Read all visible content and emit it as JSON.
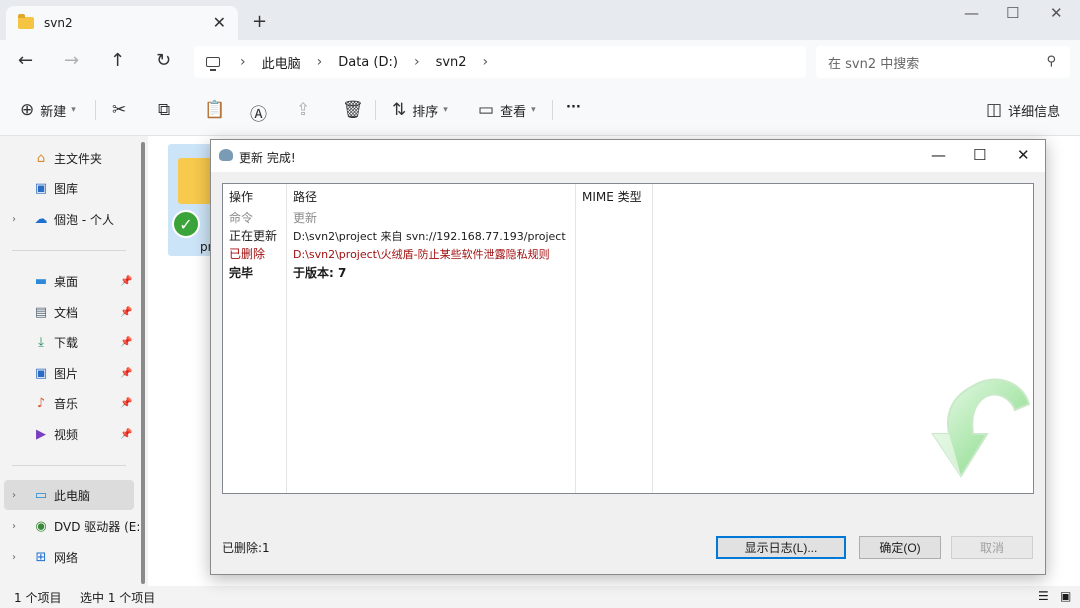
{
  "window": {
    "tab_title": "svn2",
    "tab_close": "✕",
    "new_tab": "+",
    "minimize": "—",
    "maximize": "☐",
    "close": "✕"
  },
  "nav": {
    "back": "←",
    "forward": "→",
    "up": "↑",
    "refresh": "↻"
  },
  "address": {
    "crumbs": [
      "此电脑",
      "Data (D:)",
      "svn2"
    ],
    "separator": "›"
  },
  "search": {
    "placeholder": "在 svn2 中搜索"
  },
  "toolbar": {
    "new_label": "新建",
    "sort_label": "排序",
    "view_label": "查看",
    "more": "···",
    "details_label": "详细信息"
  },
  "sidebar": {
    "items": [
      {
        "label": "主文件夹",
        "icon": "home-icon"
      },
      {
        "label": "图库",
        "icon": "gallery-icon"
      },
      {
        "label": "個泡 - 个人",
        "icon": "cloud-icon"
      },
      {
        "label": "桌面",
        "icon": "desktop-icon"
      },
      {
        "label": "文档",
        "icon": "documents-icon"
      },
      {
        "label": "下载",
        "icon": "download-icon"
      },
      {
        "label": "图片",
        "icon": "pictures-icon"
      },
      {
        "label": "音乐",
        "icon": "music-icon"
      },
      {
        "label": "视频",
        "icon": "video-icon"
      },
      {
        "label": "此电脑",
        "icon": "this-pc-icon"
      },
      {
        "label": "DVD 驱动器 (E:",
        "icon": "dvd-icon"
      },
      {
        "label": "网络",
        "icon": "network-icon"
      }
    ]
  },
  "content": {
    "file_name": "pr"
  },
  "statusbar": {
    "count": "1 个项目",
    "selected": "选中 1 个项目"
  },
  "dialog": {
    "title": "更新 完成!",
    "columns": [
      "操作",
      "路径",
      "MIME 类型"
    ],
    "rows": [
      {
        "action": "命令",
        "path": "更新"
      },
      {
        "action": "正在更新",
        "path": "D:\\svn2\\project 来自 svn://192.168.77.193/project"
      },
      {
        "action": "已删除",
        "path": "D:\\svn2\\project\\火绒盾-防止某些软件泄露隐私规则"
      },
      {
        "action": "完毕",
        "path": "于版本: 7"
      }
    ],
    "status": "已删除:1",
    "buttons": {
      "show_log": "显示日志(L)...",
      "ok": "确定(O)",
      "cancel": "取消"
    },
    "colors": {
      "deleted": "#a01010",
      "command": "#8c8c8c",
      "arrow_green": "#6fcf6f"
    }
  }
}
